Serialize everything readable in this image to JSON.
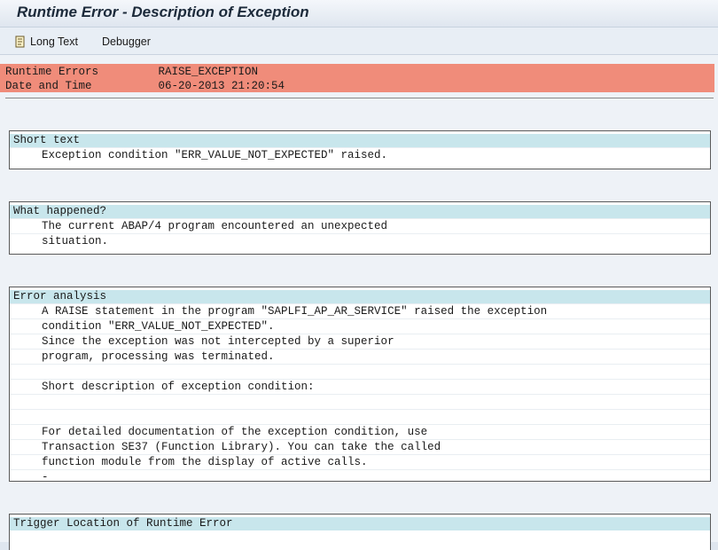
{
  "window": {
    "title": "Runtime Error - Description of Exception"
  },
  "toolbar": {
    "long_text": "Long Text",
    "debugger": "Debugger"
  },
  "header": {
    "line1": "Runtime Errors         RAISE_EXCEPTION",
    "line2": "Date and Time          06-20-2013 21:20:54"
  },
  "sections": [
    {
      "title": "Short text",
      "lines": [
        "Exception condition \"ERR_VALUE_NOT_EXPECTED\" raised."
      ]
    },
    {
      "title": "What happened?",
      "lines": [
        "The current ABAP/4 program encountered an unexpected",
        "situation."
      ]
    },
    {
      "title": "Error analysis",
      "lines": [
        "A RAISE statement in the program \"SAPLFI_AP_AR_SERVICE\" raised the exception",
        "condition \"ERR_VALUE_NOT_EXPECTED\".",
        "Since the exception was not intercepted by a superior",
        "program, processing was terminated.",
        "",
        "Short description of exception condition:",
        "",
        "",
        "For detailed documentation of the exception condition, use",
        "Transaction SE37 (Function Library). You can take the called",
        "function module from the display of active calls.",
        "-"
      ]
    },
    {
      "title": "Trigger Location of Runtime Error",
      "lines": []
    }
  ]
}
